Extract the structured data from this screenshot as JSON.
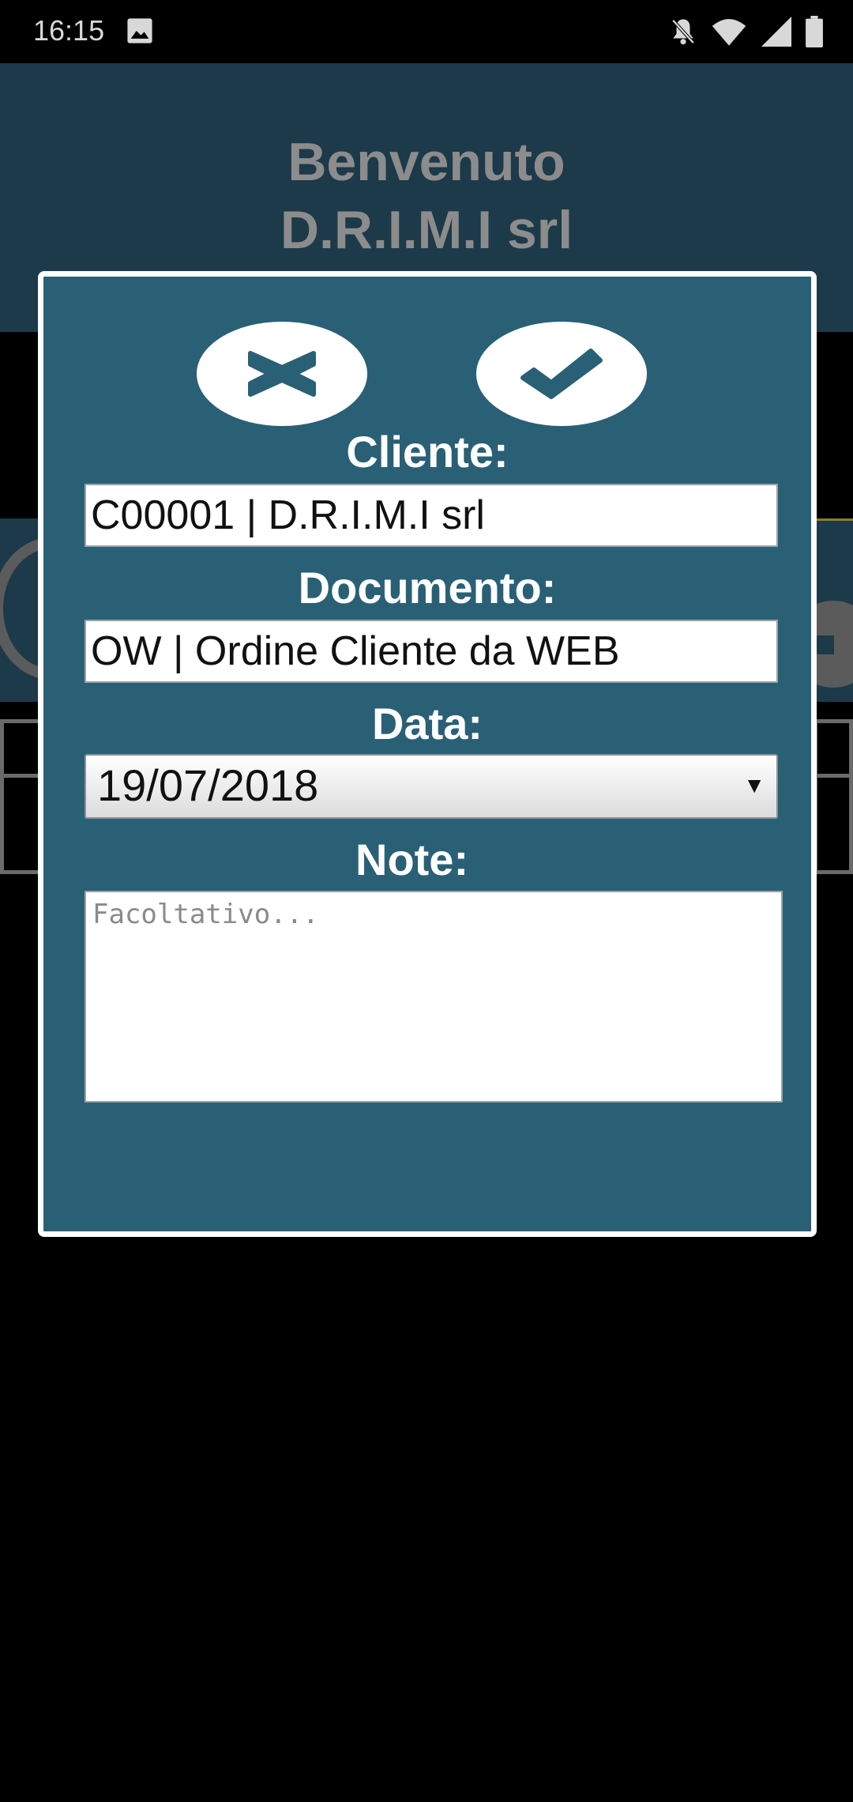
{
  "status_bar": {
    "time": "16:15",
    "icons": [
      "gallery-icon",
      "notifications-off-icon",
      "wifi-icon",
      "signal-icon",
      "battery-icon"
    ]
  },
  "header": {
    "welcome": "Benvenuto",
    "company": "D.R.I.M.I srl"
  },
  "dialog": {
    "cancel_icon": "close-icon",
    "confirm_icon": "check-icon",
    "cliente_label": "Cliente:",
    "cliente_value": "C00001 | D.R.I.M.I srl",
    "documento_label": "Documento:",
    "documento_value": "OW | Ordine Cliente da WEB",
    "data_label": "Data:",
    "data_value": "19/07/2018",
    "note_label": "Note:",
    "note_placeholder": "Facoltativo..."
  },
  "colors": {
    "modal_bg": "#2a6075",
    "header_bg": "#1c3a49",
    "title_text": "#8c8c8c"
  }
}
